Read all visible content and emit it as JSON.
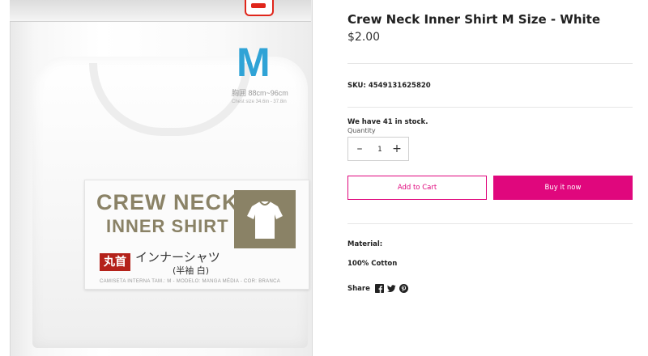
{
  "gallery": {
    "size_letter": "M",
    "size_note_line1": "胸囲 88cm~96cm",
    "size_note_line2": "Chest size 34.6in - 37.8in",
    "label_line1": "CREW NECK",
    "label_line2": "INNER SHIRT",
    "badge_text": "丸首",
    "jp_title": "インナーシャツ",
    "jp_sub": "(半袖 白)",
    "tiny_text": "CAMISETA INTERNA TAM.: M - MODELO: MANGA MÉDIA - COR: BRANCA"
  },
  "product": {
    "title": "Crew Neck Inner Shirt M Size - White",
    "price": "$2.00",
    "sku": "SKU: 4549131625820",
    "stock": "We have 41 in stock.",
    "quantity_label": "Quantity",
    "quantity_value": "1",
    "minus_symbol": "–",
    "plus_symbol": "+",
    "add_to_cart": "Add to Cart",
    "buy_now": "Buy it now",
    "material_heading": "Material:",
    "material_value": "100% Cotton",
    "share_label": "Share"
  },
  "share_icons": [
    "facebook-icon",
    "twitter-icon",
    "pinterest-icon"
  ],
  "colors": {
    "accent": "#e0077d",
    "size_letter": "#2fa3d6",
    "badge": "#b4221a",
    "label_text": "#8a8266"
  }
}
